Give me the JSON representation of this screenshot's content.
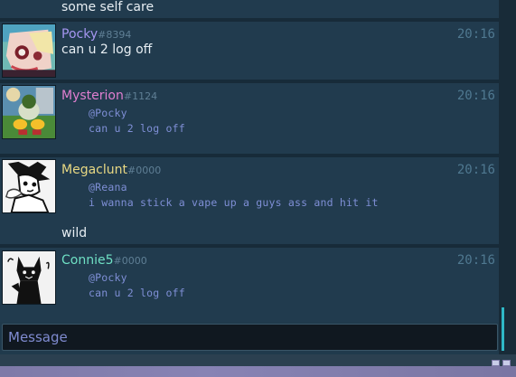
{
  "chat": {
    "prev_text": "some self care",
    "messages": [
      {
        "user": "Pocky",
        "tag": "#8394",
        "name_color": "#a596f0",
        "time": "20:16",
        "text": "can u 2 log off"
      },
      {
        "user": "Mysterion",
        "tag": "#1124",
        "name_color": "#e07fd0",
        "time": "20:16",
        "reply_to": "@Pocky",
        "reply_text": "can u 2 log off"
      },
      {
        "user": "Megaclunt",
        "tag": "#0000",
        "name_color": "#e8d883",
        "time": "20:16",
        "reply_to": "@Reana",
        "reply_text": "i wanna stick a vape up a guys ass and hit it",
        "text": "wild"
      },
      {
        "user": "Connie5",
        "tag": "#0000",
        "name_color": "#6fe0c4",
        "time": "20:16",
        "reply_to": "@Pocky",
        "reply_text": "can u 2 log off"
      }
    ]
  },
  "input": {
    "placeholder": "Message"
  }
}
